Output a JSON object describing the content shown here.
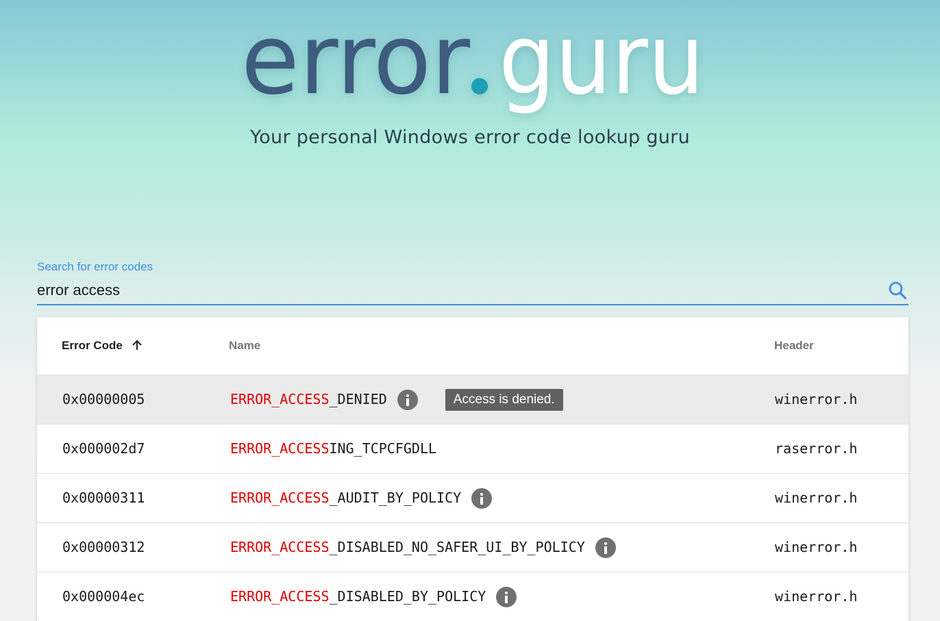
{
  "brand": {
    "logo_left": "error",
    "logo_right": "guru",
    "colors": {
      "left": "#3c5c7e",
      "dot": "#1a9fb5",
      "right": "#ffffff"
    },
    "tagline": "Your personal Windows error code lookup guru"
  },
  "search": {
    "label": "Search for error codes",
    "value": "error access",
    "icon": "search-icon",
    "accent": "#3d8fe8"
  },
  "table": {
    "columns": [
      {
        "label": "Error Code",
        "sorted": "ascending",
        "sort_icon": "arrow-up-icon"
      },
      {
        "label": "Name"
      },
      {
        "label": "Header"
      }
    ],
    "match_color": "#e00000",
    "rows": [
      {
        "code": "0x00000005",
        "name_match": "ERROR_ACCESS",
        "name_rest": "_DENIED",
        "has_info": true,
        "tooltip": "Access is denied.",
        "header": "winerror.h"
      },
      {
        "code": "0x000002d7",
        "name_match": "ERROR_ACCESS",
        "name_rest": "ING_TCPCFGDLL",
        "has_info": false,
        "tooltip": "",
        "header": "raserror.h"
      },
      {
        "code": "0x00000311",
        "name_match": "ERROR_ACCESS",
        "name_rest": "_AUDIT_BY_POLICY",
        "has_info": true,
        "tooltip": "",
        "header": "winerror.h"
      },
      {
        "code": "0x00000312",
        "name_match": "ERROR_ACCESS",
        "name_rest": "_DISABLED_NO_SAFER_UI_BY_POLICY",
        "has_info": true,
        "tooltip": "",
        "header": "winerror.h"
      },
      {
        "code": "0x000004ec",
        "name_match": "ERROR_ACCESS",
        "name_rest": "_DISABLED_BY_POLICY",
        "has_info": true,
        "tooltip": "",
        "header": "winerror.h"
      }
    ]
  }
}
